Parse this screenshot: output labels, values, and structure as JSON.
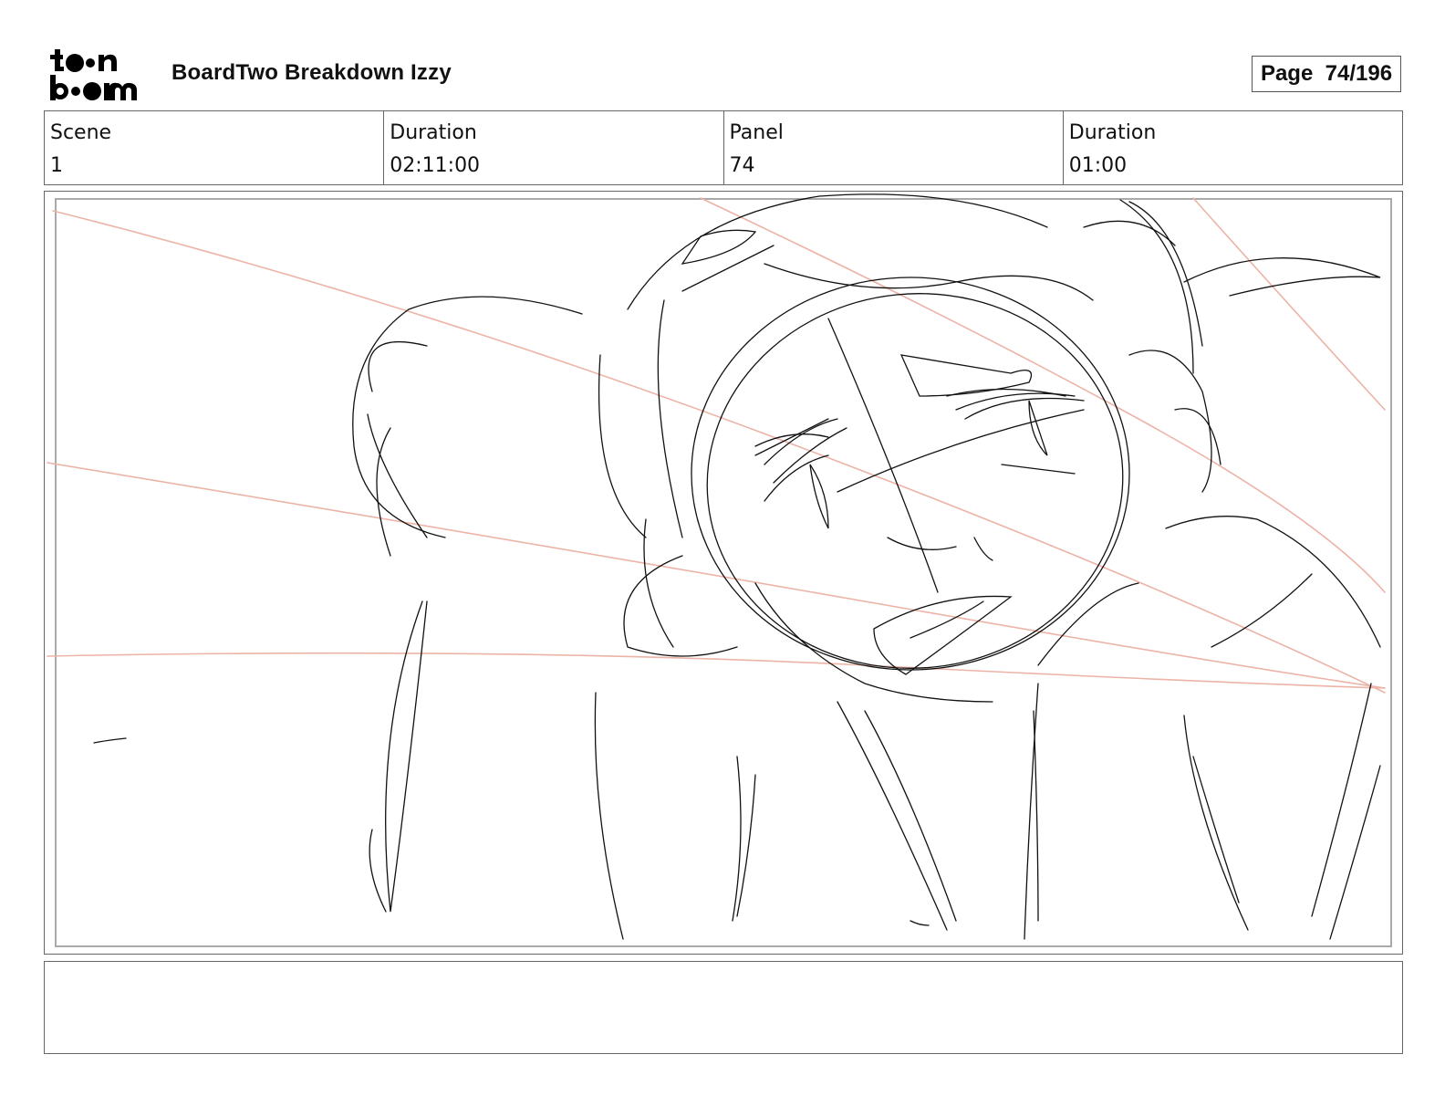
{
  "header": {
    "logo_text": "toon boom",
    "title": "BoardTwo Breakdown Izzy",
    "page_label": "Page",
    "page_value": "74/196"
  },
  "info": {
    "scene_label": "Scene",
    "scene_value": "1",
    "scene_duration_label": "Duration",
    "scene_duration_value": "02:11:00",
    "panel_label": "Panel",
    "panel_value": "74",
    "panel_duration_label": "Duration",
    "panel_duration_value": "01:00"
  },
  "notes": {
    "text": ""
  },
  "colors": {
    "sketch_line": "#111111",
    "guide_line": "#e8a898",
    "border": "#666666"
  }
}
